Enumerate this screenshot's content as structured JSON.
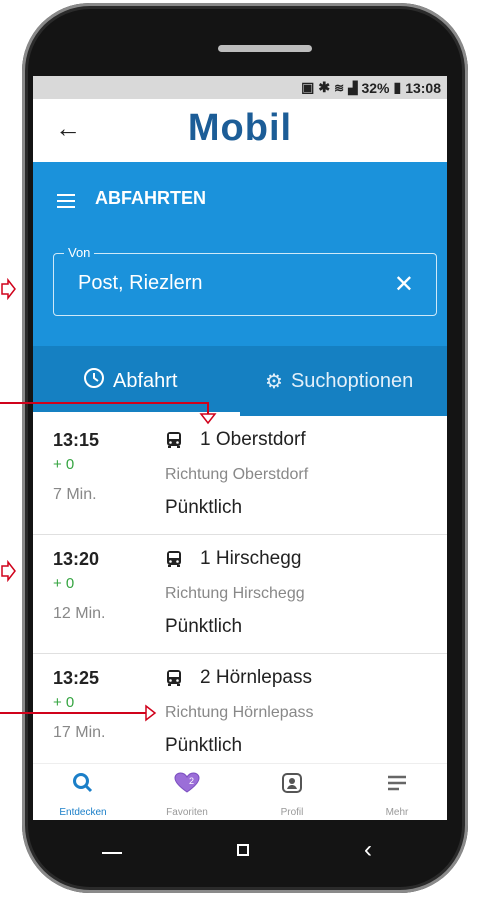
{
  "statusbar": {
    "battery_pct": "32%",
    "time": "13:08"
  },
  "appbar": {
    "logo": "Mobil",
    "back_icon": "arrow-left-icon"
  },
  "section": {
    "title": "ABFAHRTEN"
  },
  "search": {
    "label": "Von",
    "value": "Post, Riezlern",
    "clear_icon": "close-icon"
  },
  "tabs": [
    {
      "label": "Abfahrt",
      "icon": "clock-icon"
    },
    {
      "label": "Suchoptionen",
      "icon": "gear-icon"
    }
  ],
  "departures": [
    {
      "time": "13:15",
      "delay": "+ 0",
      "in": "7 Min.",
      "line": "1 Oberstdorf",
      "direction": "Richtung Oberstdorf",
      "status": "Pünktlich"
    },
    {
      "time": "13:20",
      "delay": "+ 0",
      "in": "12 Min.",
      "line": "1 Hirschegg",
      "direction": "Richtung Hirschegg",
      "status": "Pünktlich"
    },
    {
      "time": "13:25",
      "delay": "+ 0",
      "in": "17 Min.",
      "line": "2 Hörnlepass",
      "direction": "Richtung Hörnlepass",
      "status": "Pünktlich"
    }
  ],
  "bottomnav": [
    {
      "label": "Entdecken",
      "icon": "search-icon",
      "active": true
    },
    {
      "label": "Favoriten",
      "icon": "heart-icon",
      "badge": "2"
    },
    {
      "label": "Profil",
      "icon": "profile-icon"
    },
    {
      "label": "Mehr",
      "icon": "menu-icon"
    }
  ],
  "colors": {
    "primary": "#1b92db",
    "primary_dark": "#1580c2",
    "logo": "#1c5d97",
    "delay_green": "#36a542",
    "annotation_red": "#d0021b"
  }
}
